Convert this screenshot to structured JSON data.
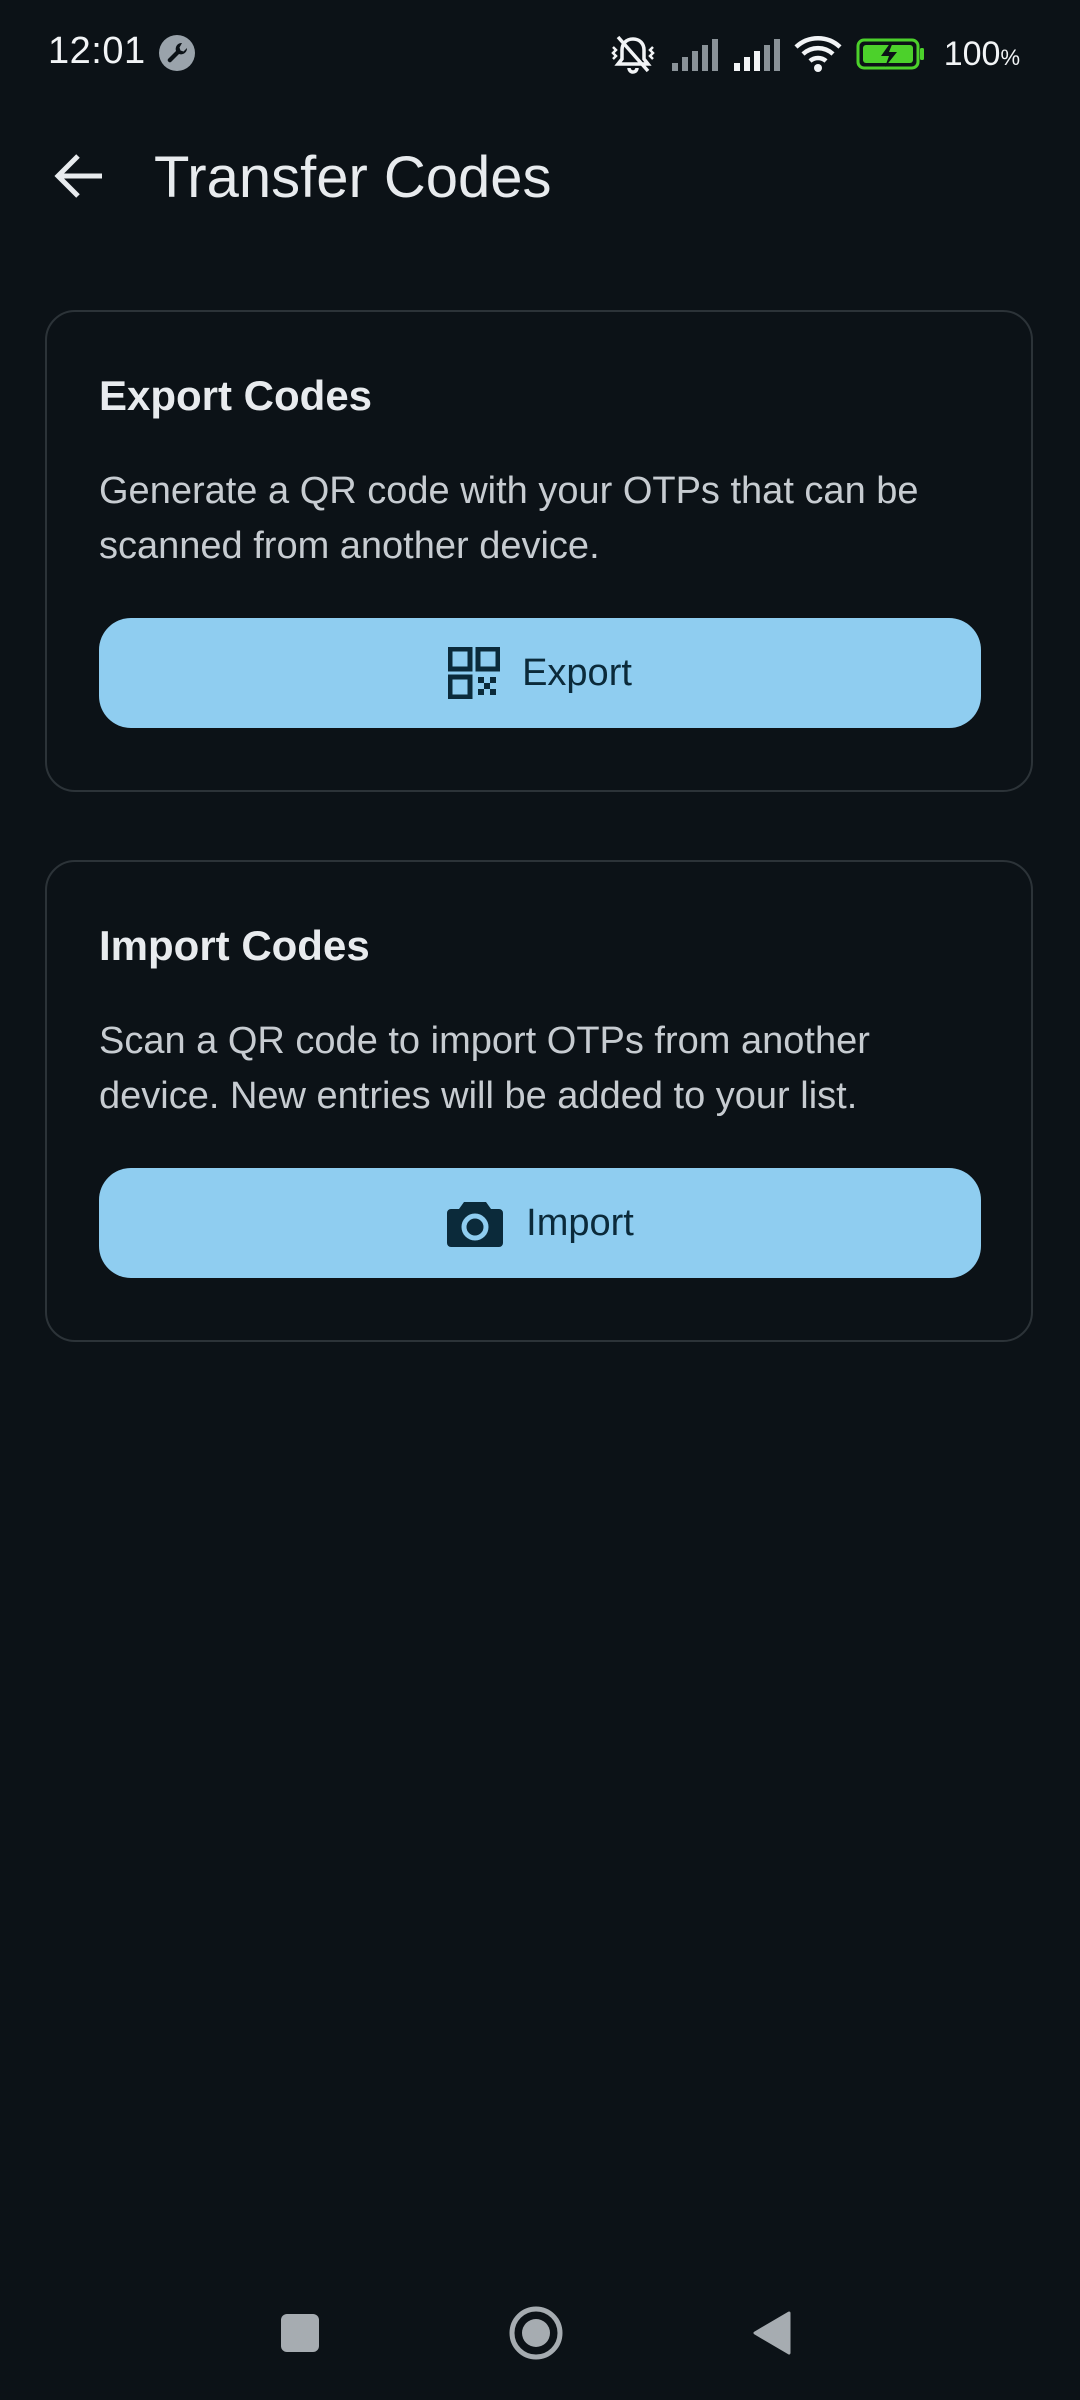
{
  "status_bar": {
    "time": "12:01",
    "battery_percent": "100",
    "battery_unit": "%",
    "icons": [
      "wrench-icon",
      "silent-icon",
      "signal-icon",
      "signal-icon",
      "wifi-icon",
      "battery-charging-icon"
    ]
  },
  "app_bar": {
    "title": "Transfer Codes",
    "back_icon": "arrow-back-icon"
  },
  "export_card": {
    "title": "Export Codes",
    "description": "Generate a QR code with your OTPs that can be scanned from another device.",
    "button_label": "Export",
    "button_icon": "qr-code-icon"
  },
  "import_card": {
    "title": "Import Codes",
    "description": "Scan a QR code to import OTPs from another device. New entries will be added to your list.",
    "button_label": "Import",
    "button_icon": "camera-icon"
  },
  "nav_bar": {
    "icons": [
      "recents-square-icon",
      "home-circle-icon",
      "back-triangle-icon"
    ]
  },
  "colors": {
    "background": "#0c1217",
    "button_fill": "#8fcdf0",
    "button_text": "#0b2a3a",
    "card_border": "#2c3338",
    "battery_green": "#4cd12b"
  }
}
